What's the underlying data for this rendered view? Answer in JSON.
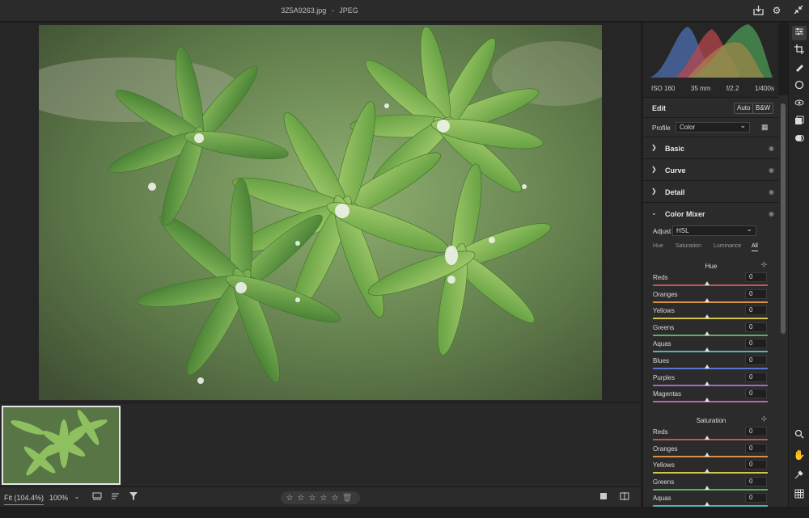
{
  "window": {
    "filename": "3Z5A9263.jpg",
    "separator": "-",
    "format": "JPEG"
  },
  "exif": {
    "iso": "ISO 160",
    "focal": "35 mm",
    "aperture": "f/2.2",
    "shutter": "1/400s"
  },
  "edit": {
    "title": "Edit",
    "auto": "Auto",
    "bw": "B&W"
  },
  "profile": {
    "label": "Profile",
    "value": "Color"
  },
  "sections": [
    {
      "label": "Basic"
    },
    {
      "label": "Curve"
    },
    {
      "label": "Detail"
    },
    {
      "label": "Color Mixer"
    }
  ],
  "color_mixer": {
    "adjust_label": "Adjust",
    "adjust_value": "HSL",
    "tabs": [
      "Hue",
      "Saturation",
      "Luminance",
      "All"
    ],
    "active_tab": "All",
    "hue_title": "Hue",
    "saturation_title": "Saturation",
    "hue": [
      {
        "name": "Reds",
        "value": "0"
      },
      {
        "name": "Oranges",
        "value": "0"
      },
      {
        "name": "Yellows",
        "value": "0"
      },
      {
        "name": "Greens",
        "value": "0"
      },
      {
        "name": "Aquas",
        "value": "0"
      },
      {
        "name": "Blues",
        "value": "0"
      },
      {
        "name": "Purples",
        "value": "0"
      },
      {
        "name": "Magentas",
        "value": "0"
      }
    ],
    "saturation": [
      {
        "name": "Reds",
        "value": "0"
      },
      {
        "name": "Oranges",
        "value": "0"
      },
      {
        "name": "Yellows",
        "value": "0"
      },
      {
        "name": "Greens",
        "value": "0"
      },
      {
        "name": "Aquas",
        "value": "0"
      }
    ]
  },
  "bottom": {
    "fit": "Fit (104.4%)",
    "zoom": "100%",
    "stars": [
      "☆",
      "☆",
      "☆",
      "☆",
      "☆"
    ]
  },
  "colors": {
    "panel": "#2b2b2b",
    "background": "#1e1e1e",
    "hue_tracks": [
      "#c7525a",
      "#d89247",
      "#d2c44b",
      "#5fae5c",
      "#4fb5b3",
      "#5776d0",
      "#9b6ad0",
      "#c35eb5"
    ]
  },
  "icons": {
    "titlebar": [
      "export-icon",
      "gear-icon",
      "collapse-icon"
    ],
    "tools": [
      "sliders-icon",
      "crop-icon",
      "healing-brush-icon",
      "mask-icon",
      "red-eye-icon",
      "snapshot-icon",
      "presets-icon",
      "zoom-icon",
      "hand-icon",
      "sampler-icon",
      "grid-icon"
    ]
  }
}
